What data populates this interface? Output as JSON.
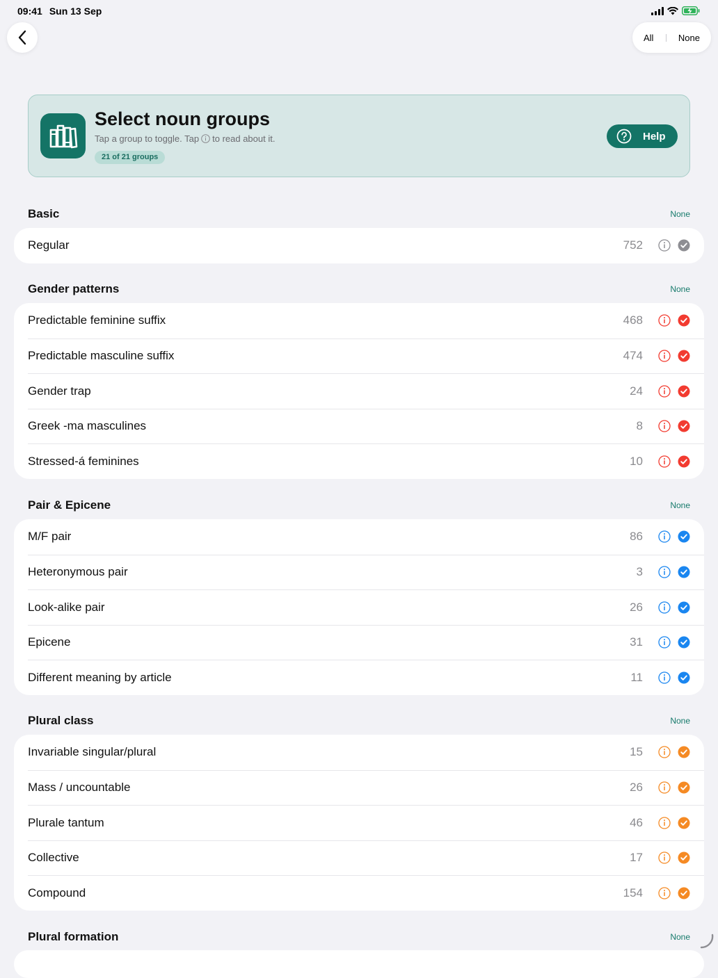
{
  "status_bar": {
    "time": "09:41",
    "date": "Sun 13 Sep"
  },
  "top_controls": {
    "all_label": "All",
    "none_label": "None"
  },
  "header": {
    "title": "Select noun groups",
    "subtitle_before": "Tap a group to toggle. Tap",
    "subtitle_after": "to read about it.",
    "count_pill": "21 of 21 groups",
    "help_label": "Help"
  },
  "colors": {
    "basic": "#8e8e93",
    "gender": "#f23b30",
    "pair": "#1a86f0",
    "plural": "#f58a24",
    "accent": "#147466"
  },
  "sections": [
    {
      "title": "Basic",
      "none_label": "None",
      "color_key": "basic",
      "items": [
        {
          "label": "Regular",
          "count": "752"
        }
      ]
    },
    {
      "title": "Gender patterns",
      "none_label": "None",
      "color_key": "gender",
      "items": [
        {
          "label": "Predictable feminine suffix",
          "count": "468"
        },
        {
          "label": "Predictable masculine suffix",
          "count": "474"
        },
        {
          "label": "Gender trap",
          "count": "24"
        },
        {
          "label": "Greek -ma masculines",
          "count": "8"
        },
        {
          "label": "Stressed-á feminines",
          "count": "10"
        }
      ]
    },
    {
      "title": "Pair & Epicene",
      "none_label": "None",
      "color_key": "pair",
      "items": [
        {
          "label": "M/F pair",
          "count": "86"
        },
        {
          "label": "Heteronymous pair",
          "count": "3"
        },
        {
          "label": "Look-alike pair",
          "count": "26"
        },
        {
          "label": "Epicene",
          "count": "31"
        },
        {
          "label": "Different meaning by article",
          "count": "11"
        }
      ]
    },
    {
      "title": "Plural class",
      "none_label": "None",
      "color_key": "plural",
      "items": [
        {
          "label": "Invariable singular/plural",
          "count": "15"
        },
        {
          "label": "Mass / uncountable",
          "count": "26"
        },
        {
          "label": "Plurale tantum",
          "count": "46"
        },
        {
          "label": "Collective",
          "count": "17"
        },
        {
          "label": "Compound",
          "count": "154"
        }
      ]
    },
    {
      "title": "Plural formation",
      "none_label": "None",
      "color_key": "plural",
      "items": []
    }
  ]
}
